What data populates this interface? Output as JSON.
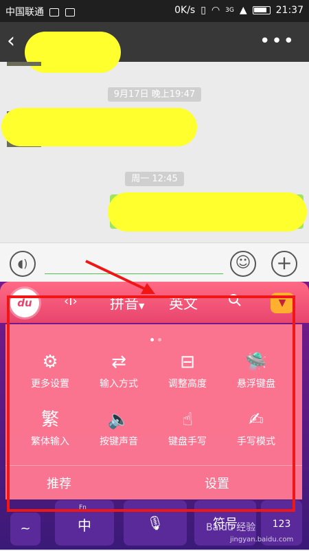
{
  "status_bar": {
    "carrier": "中国联通",
    "network_speed": "0K/s",
    "signal_type": "3G",
    "time": "21:37"
  },
  "chat": {
    "timestamp_1": "9月17日 晚上19:47",
    "timestamp_2": "周一 12:45"
  },
  "colors": {
    "redaction": "#ffff2e",
    "keyboard_pink": "#e8456e",
    "annotation_red": "#f01616"
  },
  "keyboard": {
    "logo": "du",
    "tabs": [
      "拼音",
      "英文"
    ],
    "panel_items": [
      {
        "label": "更多设置",
        "icon": "gear-icon"
      },
      {
        "label": "输入方式",
        "icon": "input-method-icon"
      },
      {
        "label": "调整高度",
        "icon": "adjust-height-icon"
      },
      {
        "label": "悬浮键盘",
        "icon": "floating-keyboard-icon"
      },
      {
        "label": "繁体输入",
        "icon": "traditional-char-icon",
        "glyph": "繁"
      },
      {
        "label": "按键声音",
        "icon": "speaker-icon"
      },
      {
        "label": "键盘手写",
        "icon": "keyboard-handwriting-icon"
      },
      {
        "label": "手写模式",
        "icon": "handwriting-mode-icon"
      }
    ],
    "bottom_tabs": [
      "推荐",
      "设置"
    ],
    "keys": {
      "tilde": "~",
      "fn": "Fn",
      "zh": "中",
      "symbol": "符号",
      "num": "123"
    }
  },
  "watermark": {
    "brand": "Baidu 经验",
    "site": "jingyan.baidu.com"
  }
}
